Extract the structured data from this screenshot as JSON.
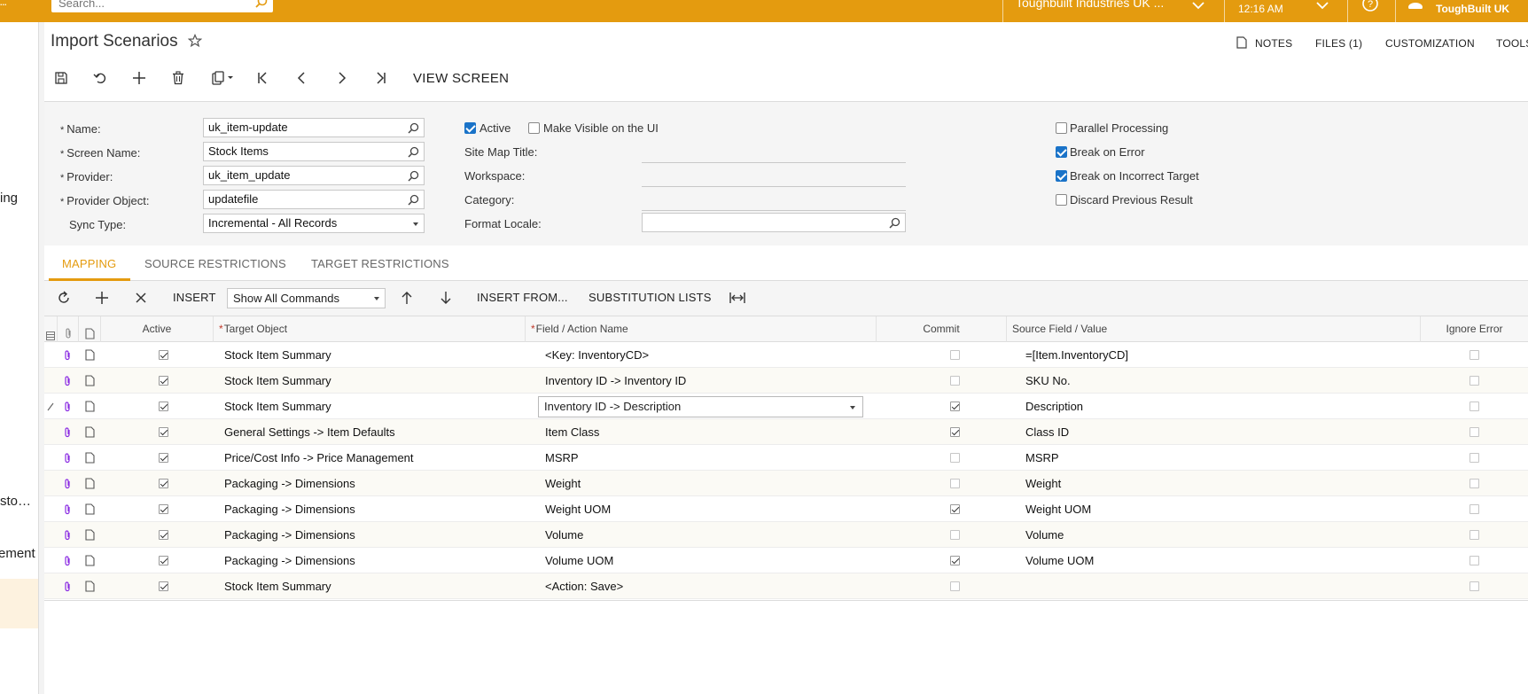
{
  "topbar": {
    "search_placeholder": "Search...",
    "company": "Toughbuilt Industries UK ...",
    "time": "12:16 AM",
    "user": "ToughBuilt UK",
    "logo_fragment": "..."
  },
  "leftnav": {
    "items": [
      "ing",
      "sto…",
      "ement"
    ]
  },
  "header": {
    "title": "Import Scenarios",
    "links": [
      "NOTES",
      "FILES (1)",
      "CUSTOMIZATION",
      "TOOLS"
    ]
  },
  "toolbar": {
    "view_screen": "VIEW SCREEN"
  },
  "form": {
    "name_label": "Name:",
    "name_value": "uk_item-update",
    "screen_name_label": "Screen Name:",
    "screen_name_value": "Stock Items",
    "provider_label": "Provider:",
    "provider_value": "uk_item_update",
    "provider_object_label": "Provider Object:",
    "provider_object_value": "updatefile",
    "sync_type_label": "Sync Type:",
    "sync_type_value": "Incremental - All Records",
    "active_label": "Active",
    "active_checked": true,
    "visible_label": "Make Visible on the UI",
    "visible_checked": false,
    "site_map_title_label": "Site Map Title:",
    "workspace_label": "Workspace:",
    "category_label": "Category:",
    "format_locale_label": "Format Locale:",
    "parallel_label": "Parallel Processing",
    "parallel_checked": false,
    "break_error_label": "Break on Error",
    "break_error_checked": true,
    "break_target_label": "Break on Incorrect Target",
    "break_target_checked": true,
    "discard_label": "Discard Previous Result",
    "discard_checked": false
  },
  "tabs": [
    "MAPPING",
    "SOURCE RESTRICTIONS",
    "TARGET RESTRICTIONS"
  ],
  "grid_toolbar": {
    "insert": "INSERT",
    "commands_select": "Show All Commands",
    "insert_from": "INSERT FROM...",
    "substitution_lists": "SUBSTITUTION LISTS"
  },
  "grid": {
    "headers": {
      "active": "Active",
      "target_object": "Target Object",
      "field_action": "Field / Action Name",
      "commit": "Commit",
      "source_field": "Source Field / Value",
      "ignore_error": "Ignore Error"
    },
    "rows": [
      {
        "active": true,
        "target": "Stock Item Summary",
        "field": "<Key: InventoryCD>",
        "commit": false,
        "source": "=[Item.InventoryCD]",
        "ignore": false
      },
      {
        "active": true,
        "target": "Stock Item Summary",
        "field": "Inventory ID -> Inventory ID",
        "commit": false,
        "source": "SKU No.",
        "ignore": false
      },
      {
        "active": true,
        "target": "Stock Item Summary",
        "field": "Inventory ID -> Description",
        "commit": true,
        "source": "Description",
        "ignore": false,
        "editing": true
      },
      {
        "active": true,
        "target": "General Settings -> Item Defaults",
        "field": "Item Class",
        "commit": true,
        "source": "Class ID",
        "ignore": false
      },
      {
        "active": true,
        "target": "Price/Cost Info -> Price Management",
        "field": "MSRP",
        "commit": false,
        "source": "MSRP",
        "ignore": false
      },
      {
        "active": true,
        "target": "Packaging -> Dimensions",
        "field": "Weight",
        "commit": false,
        "source": "Weight",
        "ignore": false
      },
      {
        "active": true,
        "target": "Packaging -> Dimensions",
        "field": "Weight UOM",
        "commit": true,
        "source": "Weight UOM",
        "ignore": false
      },
      {
        "active": true,
        "target": "Packaging -> Dimensions",
        "field": "Volume",
        "commit": false,
        "source": "Volume",
        "ignore": false
      },
      {
        "active": true,
        "target": "Packaging -> Dimensions",
        "field": "Volume UOM",
        "commit": true,
        "source": "Volume UOM",
        "ignore": false
      },
      {
        "active": true,
        "target": "Stock Item Summary",
        "field": "<Action: Save>",
        "commit": false,
        "source": "",
        "ignore": false
      }
    ]
  },
  "colors": {
    "accent": "#e49b0f",
    "panel": "#f5f5f5",
    "checkbox_on": "#1a73c8"
  }
}
